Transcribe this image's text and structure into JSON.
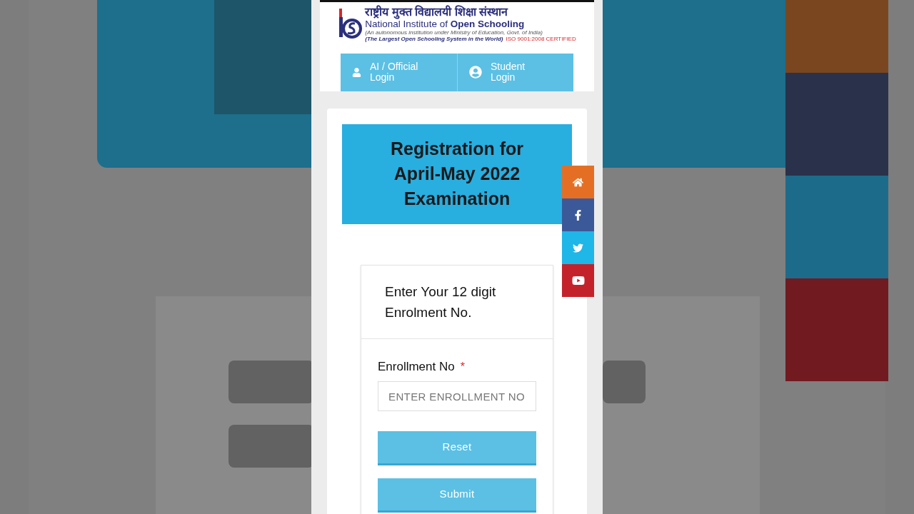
{
  "header": {
    "hindi_name": "राष्ट्रीय मुक्त विद्यालयी शिक्षा संस्थान",
    "english_name": "National Institute of **Open Schooling**",
    "tagline": "(An autonomous institution under Ministry of Education, Govt. of India)",
    "motto": "(The Largest Open Schooling System in the World)",
    "certification": "ISO 9001:2008 CERTIFIED"
  },
  "login_tabs": [
    {
      "label": "AI / Official Login",
      "kind": "official"
    },
    {
      "label": "Student Login",
      "kind": "student"
    }
  ],
  "banner": {
    "title": "Registration for April-May 2022 Examination"
  },
  "social": [
    {
      "kind": "home",
      "color": "#e46f24"
    },
    {
      "kind": "facebook",
      "color": "#3b5998"
    },
    {
      "kind": "twitter",
      "color": "#1fb6e8"
    },
    {
      "kind": "youtube",
      "color": "#c4222b"
    }
  ],
  "form": {
    "heading": "Enter Your 12 digit Enrolment No.",
    "field_label": "Enrollment No",
    "required_mark": "*",
    "placeholder": "ENTER ENROLLMENT NO",
    "buttons": [
      "Reset",
      "Submit"
    ]
  }
}
